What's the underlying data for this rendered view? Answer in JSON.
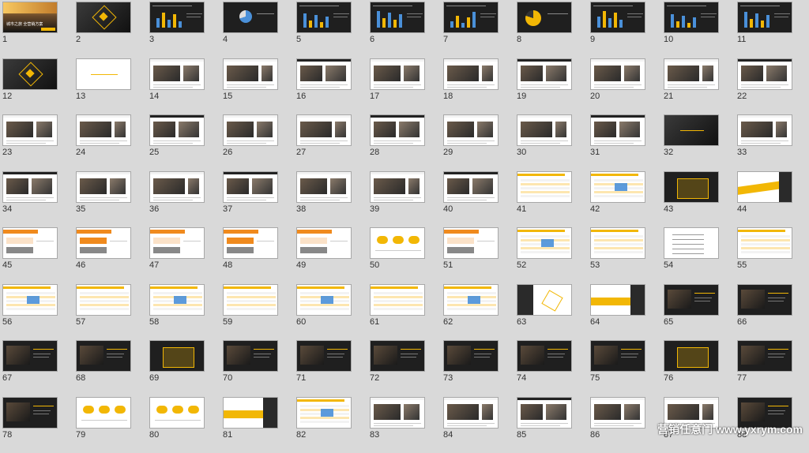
{
  "slides": [
    {
      "n": "1",
      "theme": "cover",
      "title": "城市之旅 全营销方案"
    },
    {
      "n": "2",
      "theme": "dark-diamond"
    },
    {
      "n": "3",
      "theme": "dark-bars"
    },
    {
      "n": "4",
      "theme": "dark-pie"
    },
    {
      "n": "5",
      "theme": "dark-bars"
    },
    {
      "n": "6",
      "theme": "dark-bars"
    },
    {
      "n": "7",
      "theme": "dark-bars"
    },
    {
      "n": "8",
      "theme": "dark-yellow-pie"
    },
    {
      "n": "9",
      "theme": "dark-bars"
    },
    {
      "n": "10",
      "theme": "dark-bars"
    },
    {
      "n": "11",
      "theme": "dark-bars"
    },
    {
      "n": "12",
      "theme": "dark-diamond"
    },
    {
      "n": "13",
      "theme": "white-center"
    },
    {
      "n": "14",
      "theme": "white-photo"
    },
    {
      "n": "15",
      "theme": "white-photo"
    },
    {
      "n": "16",
      "theme": "white-photo"
    },
    {
      "n": "17",
      "theme": "white-photo"
    },
    {
      "n": "18",
      "theme": "white-photo"
    },
    {
      "n": "19",
      "theme": "white-photo"
    },
    {
      "n": "20",
      "theme": "white-photo"
    },
    {
      "n": "21",
      "theme": "white-photo"
    },
    {
      "n": "22",
      "theme": "white-photo"
    },
    {
      "n": "23",
      "theme": "white-photo"
    },
    {
      "n": "24",
      "theme": "white-photo"
    },
    {
      "n": "25",
      "theme": "white-photo"
    },
    {
      "n": "26",
      "theme": "white-photo"
    },
    {
      "n": "27",
      "theme": "white-photo"
    },
    {
      "n": "28",
      "theme": "white-photo"
    },
    {
      "n": "29",
      "theme": "white-photo"
    },
    {
      "n": "30",
      "theme": "white-photo"
    },
    {
      "n": "31",
      "theme": "white-photo"
    },
    {
      "n": "32",
      "theme": "dark-center"
    },
    {
      "n": "33",
      "theme": "white-photo"
    },
    {
      "n": "34",
      "theme": "white-photo"
    },
    {
      "n": "35",
      "theme": "white-photo"
    },
    {
      "n": "36",
      "theme": "white-photo"
    },
    {
      "n": "37",
      "theme": "white-photo"
    },
    {
      "n": "38",
      "theme": "white-photo"
    },
    {
      "n": "39",
      "theme": "white-photo"
    },
    {
      "n": "40",
      "theme": "white-photo"
    },
    {
      "n": "41",
      "theme": "white-table"
    },
    {
      "n": "42",
      "theme": "white-table"
    },
    {
      "n": "43",
      "theme": "dark-yellow-box"
    },
    {
      "n": "44",
      "theme": "white-yellow-band"
    },
    {
      "n": "45",
      "theme": "white-orange"
    },
    {
      "n": "46",
      "theme": "white-orange"
    },
    {
      "n": "47",
      "theme": "white-orange"
    },
    {
      "n": "48",
      "theme": "white-orange"
    },
    {
      "n": "49",
      "theme": "white-orange"
    },
    {
      "n": "50",
      "theme": "white-clouds"
    },
    {
      "n": "51",
      "theme": "white-orange"
    },
    {
      "n": "52",
      "theme": "white-table"
    },
    {
      "n": "53",
      "theme": "white-table"
    },
    {
      "n": "54",
      "theme": "white-list"
    },
    {
      "n": "55",
      "theme": "white-table"
    },
    {
      "n": "56",
      "theme": "white-table"
    },
    {
      "n": "57",
      "theme": "white-table"
    },
    {
      "n": "58",
      "theme": "white-table"
    },
    {
      "n": "59",
      "theme": "white-table"
    },
    {
      "n": "60",
      "theme": "white-table"
    },
    {
      "n": "61",
      "theme": "white-table"
    },
    {
      "n": "62",
      "theme": "white-table"
    },
    {
      "n": "63",
      "theme": "white-hex"
    },
    {
      "n": "64",
      "theme": "white-section"
    },
    {
      "n": "65",
      "theme": "dark-photo"
    },
    {
      "n": "66",
      "theme": "dark-photo"
    },
    {
      "n": "67",
      "theme": "dark-photo"
    },
    {
      "n": "68",
      "theme": "dark-photo"
    },
    {
      "n": "69",
      "theme": "dark-yellow-box"
    },
    {
      "n": "70",
      "theme": "dark-photo"
    },
    {
      "n": "71",
      "theme": "dark-photo"
    },
    {
      "n": "72",
      "theme": "dark-photo"
    },
    {
      "n": "73",
      "theme": "dark-photo"
    },
    {
      "n": "74",
      "theme": "dark-photo"
    },
    {
      "n": "75",
      "theme": "dark-photo"
    },
    {
      "n": "76",
      "theme": "dark-yellow-box"
    },
    {
      "n": "77",
      "theme": "dark-photo"
    },
    {
      "n": "78",
      "theme": "dark-photo"
    },
    {
      "n": "79",
      "theme": "white-clouds"
    },
    {
      "n": "80",
      "theme": "white-clouds"
    },
    {
      "n": "81",
      "theme": "white-section"
    },
    {
      "n": "82",
      "theme": "white-table"
    },
    {
      "n": "83",
      "theme": "white-photo"
    },
    {
      "n": "84",
      "theme": "white-photo"
    },
    {
      "n": "85",
      "theme": "white-photo"
    },
    {
      "n": "86",
      "theme": "white-photo"
    },
    {
      "n": "87",
      "theme": "white-photo"
    },
    {
      "n": "88",
      "theme": "dark-photo"
    }
  ],
  "watermark": "营销任意门 www.yxrym.com",
  "colors": {
    "accent": "#f2b705",
    "orange": "#f08a1d",
    "dark": "#1f1f1f"
  }
}
